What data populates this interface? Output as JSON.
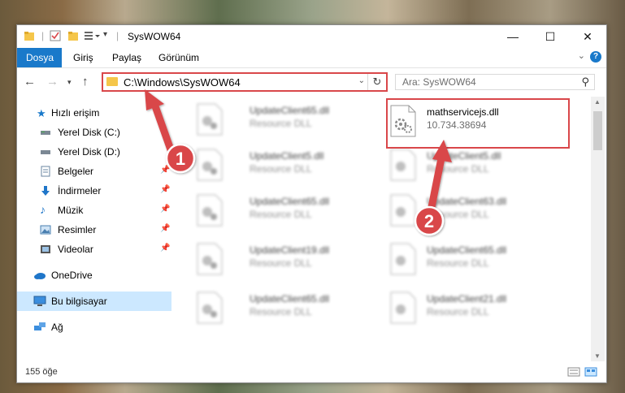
{
  "window": {
    "title": "SysWOW64"
  },
  "ribbon": {
    "tabs": [
      "Dosya",
      "Giriş",
      "Paylaş",
      "Görünüm"
    ],
    "help": "?"
  },
  "address": {
    "path": "C:\\Windows\\SysWOW64"
  },
  "search": {
    "placeholder": "Ara: SysWOW64"
  },
  "nav": {
    "quick_access": "Hızlı erişim",
    "items": [
      {
        "label": "Yerel Disk (C:)",
        "icon": "drive-icon",
        "pinned": false
      },
      {
        "label": "Yerel Disk (D:)",
        "icon": "drive-icon",
        "pinned": false
      },
      {
        "label": "Belgeler",
        "icon": "documents-icon",
        "pinned": true
      },
      {
        "label": "İndirmeler",
        "icon": "download-icon",
        "pinned": true
      },
      {
        "label": "Müzik",
        "icon": "music-icon",
        "pinned": true
      },
      {
        "label": "Resimler",
        "icon": "pictures-icon",
        "pinned": true
      },
      {
        "label": "Videolar",
        "icon": "videos-icon",
        "pinned": true
      }
    ],
    "onedrive": "OneDrive",
    "this_pc": "Bu bilgisayar",
    "network": "Ağ"
  },
  "files": {
    "left": [
      {
        "name": "UpdateClient65.dll",
        "type": "Resource DLL"
      },
      {
        "name": "UpdateClient5.dll",
        "type": "Resource DLL"
      },
      {
        "name": "UpdateClient65.dll",
        "type": "Resource DLL"
      },
      {
        "name": "UpdateClient19.dll",
        "type": "Resource DLL"
      },
      {
        "name": "UpdateClient65.dll",
        "type": "Resource DLL"
      }
    ],
    "right": [
      {
        "name": "mathservicejs.dll",
        "type": "10.734.38694"
      },
      {
        "name": "UpdateClient5.dll",
        "type": "Resource DLL"
      },
      {
        "name": "UpdateClient63.dll",
        "type": "Resource DLL"
      },
      {
        "name": "UpdateClient65.dll",
        "type": "Resource DLL"
      },
      {
        "name": "UpdateClient21.dll",
        "type": "Resource DLL"
      }
    ]
  },
  "status": {
    "count": "155 öğe"
  },
  "annotations": {
    "step1": "1",
    "step2": "2",
    "color": "#d9474a"
  }
}
